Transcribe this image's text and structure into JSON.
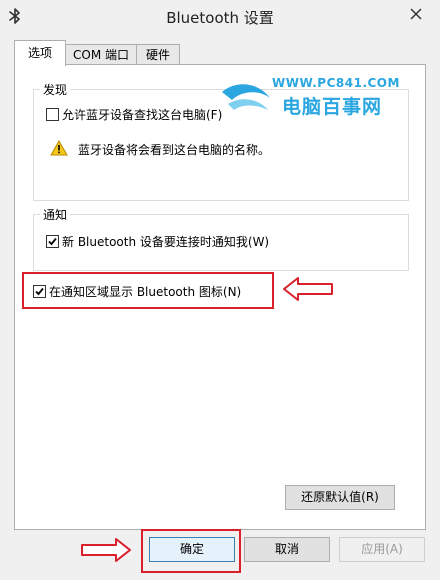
{
  "window": {
    "title": "Bluetooth 设置"
  },
  "tabs": [
    {
      "label": "选项",
      "active": true
    },
    {
      "label": "COM 端口",
      "active": false
    },
    {
      "label": "硬件",
      "active": false
    }
  ],
  "discovery": {
    "title": "发现",
    "allow_label": "允许蓝牙设备查找这台电脑(F)",
    "allow_checked": false,
    "warning_text": "蓝牙设备将会看到这台电脑的名称。"
  },
  "notifications": {
    "title": "通知",
    "notify_label": "新 Bluetooth 设备要连接时通知我(W)",
    "notify_checked": true
  },
  "tray": {
    "show_icon_label": "在通知区域显示 Bluetooth 图标(N)",
    "show_icon_checked": true
  },
  "buttons": {
    "restore_defaults": "还原默认值(R)",
    "ok": "确定",
    "cancel": "取消",
    "apply": "应用(A)"
  },
  "watermark": {
    "url": "WWW.PC841.COM",
    "name": "电脑百事网"
  },
  "colors": {
    "highlight_red": "#d9202b",
    "watermark_blue": "#2aa6e0"
  }
}
